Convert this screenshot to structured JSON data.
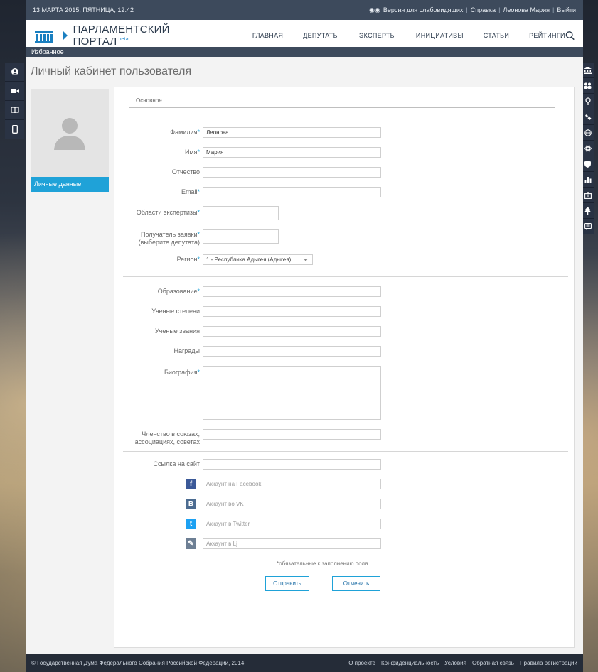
{
  "topbar": {
    "datetime": "13 МАРТА 2015, ПЯТНИЦА, 12:42",
    "accessibility": "Версия для слабовидящих",
    "help": "Справка",
    "user": "Леонова Мария",
    "logout": "Выйти"
  },
  "header": {
    "title": "ПАРЛАМЕНТСКИЙ ПОРТАЛ",
    "beta": "beta",
    "nav": [
      "ГЛАВНАЯ",
      "ДЕПУТАТЫ",
      "ЭКСПЕРТЫ",
      "ИНИЦИАТИВЫ",
      "СТАТЬИ",
      "РЕЙТИНГИ"
    ]
  },
  "favorites": "Избранное",
  "page_title": "Личный кабинет пользователя",
  "profile": {
    "tab_label": "Личные данные"
  },
  "form": {
    "section_title": "Основное",
    "fields": {
      "surname": {
        "label": "Фамилия",
        "value": "Леонова"
      },
      "name": {
        "label": "Имя",
        "value": "Мария"
      },
      "patronymic": {
        "label": "Отчество",
        "value": ""
      },
      "email": {
        "label": "Email",
        "value": ""
      },
      "expertise": {
        "label": "Области экспертизы",
        "value": ""
      },
      "recipient_line1": "Получатель заявки",
      "recipient_line2": "(выберите депутата)",
      "region": {
        "label": "Регион",
        "value": "1 - Республика Адыгея (Адыгея)"
      },
      "education": {
        "label": "Образование"
      },
      "degrees": {
        "label": "Ученые степени"
      },
      "titles": {
        "label": "Ученые звания"
      },
      "awards": {
        "label": "Награды"
      },
      "biography": {
        "label": "Биография"
      },
      "membership_line1": "Членство в союзах,",
      "membership_line2": "ассоциациях, советах",
      "website": {
        "label": "Ссылка на сайт"
      },
      "facebook": {
        "placeholder": "Аккаунт на Facebook"
      },
      "vk": {
        "placeholder": "Аккаунт во VK"
      },
      "twitter": {
        "placeholder": "Аккаунт в Twitter"
      },
      "lj": {
        "placeholder": "Аккаунт в Lj"
      }
    },
    "required_marker": "*",
    "required_note": "*обязательные к заполнению поля",
    "submit": "Отправить",
    "cancel": "Отменить"
  },
  "social_icons": {
    "facebook": "f",
    "vk": "B",
    "twitter": "t",
    "lj": "✎"
  },
  "footer": {
    "copyright": "© Государственная Дума Федерального Собрания Российской Федерации, 2014",
    "links": [
      "О проекте",
      "Конфиденциальность",
      "Условия",
      "Обратная связь",
      "Правила регистрации"
    ]
  },
  "colors": {
    "accent": "#1fa2d8",
    "dark": "#3d4a5c",
    "rail": "#2a3344"
  }
}
